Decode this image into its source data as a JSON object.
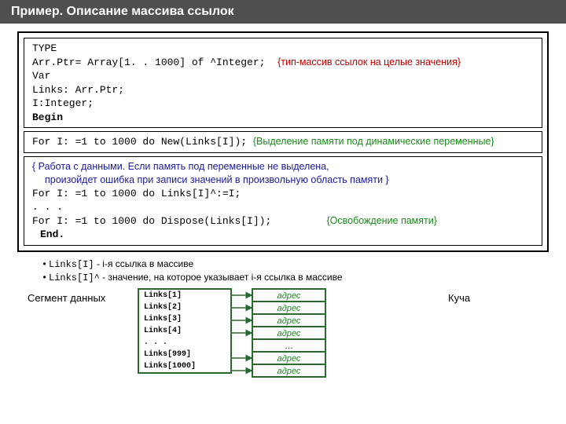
{
  "title": "Пример. Описание массива ссылок",
  "code": {
    "l1": "TYPE",
    "l2": "  Arr.Ptr= Array[1. . 1000] of ^Integer;",
    "c2": "{тип-массив ссылок на целые значения}",
    "l3": "Var",
    "l4": "  Links: Arr.Ptr;",
    "l5": "  I:Integer;",
    "l6": "Begin",
    "l7": "For I: =1 to 1000 do New(Links[I]);",
    "c7": "{Выделение памяти под динамические переменные}",
    "c8a": "{ Работа с данными.  Если память под переменные не выделена,",
    "c8b": "произойдет ошибка при записи значений в произвольную область памяти }",
    "l9": "For I: =1 to 1000 do Links[I]^:=I;",
    "l10": ". . .",
    "l11": "For I: =1 to 1000 do Dispose(Links[I]);",
    "c11": "{Освобождение памяти}",
    "l12": "End."
  },
  "bullets": {
    "b1_mono": "Links[I]",
    "b1_rest": " - i-я ссылка в массиве",
    "b2_mono": "Links[I]^",
    "b2_rest": " - значение, на которое указывает i-я ссылка в массиве"
  },
  "seg_label": "Сегмент данных",
  "heap_label": "Куча",
  "seg_rows": {
    "r1": "Links[1]",
    "r2": "Links[2]",
    "r3": "Links[3]",
    "r4": "Links[4]",
    "r5": ". . .",
    "r6": "Links[999]",
    "r7": "Links[1000]"
  },
  "heap_rows": {
    "h1": "адрес",
    "h2": "адрес",
    "h3": "адрес",
    "h4": "адрес",
    "h5": "…",
    "h6": "адрес",
    "h7": "адрес"
  }
}
